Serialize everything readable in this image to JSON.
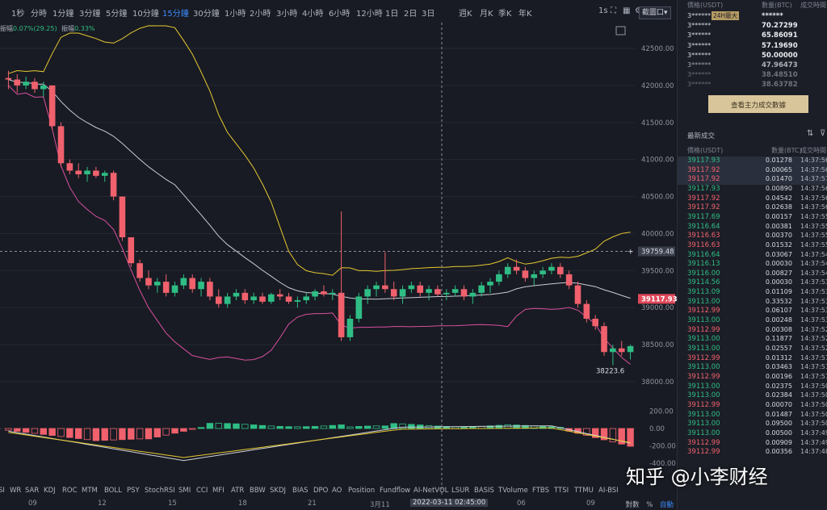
{
  "periods": {
    "items": [
      "1秒",
      "分時",
      "1分鐘",
      "3分鐘",
      "5分鐘",
      "10分鐘",
      "15分鐘",
      "30分鐘",
      "1小時",
      "2小時",
      "3小時",
      "4小時",
      "6小時",
      "12小時",
      "1日",
      "2日",
      "3日",
      "週K",
      "月K",
      "季K",
      "年K"
    ],
    "active": "15分鐘"
  },
  "toolbar": {
    "interval_short": "1s",
    "screenshot_label": "截圖口▾"
  },
  "amplitude": {
    "label": "振幅",
    "change": "0.07%(29.25)",
    "label2": "振幅",
    "value2": "0.33%"
  },
  "price_axis": {
    "ticks": [
      "42500.00",
      "42000.00",
      "41500.00",
      "41000.00",
      "40500.00",
      "40000.00",
      "39500.00",
      "39000.00",
      "38500.00",
      "38000.00"
    ],
    "crosshair_price": "39759.48",
    "last_price": "39117.93",
    "low_label": "38223.6"
  },
  "macd_axis": {
    "ticks": [
      "200.00",
      "0.00",
      "-200.00",
      "-400.00"
    ]
  },
  "indicators": [
    "SI",
    "WR",
    "SAR",
    "KDJ",
    "ROC",
    "MTM",
    "BOLL",
    "PSY",
    "StochRSI",
    "SMI",
    "CCI",
    "MFI",
    "ATR",
    "BBW",
    "SKDJ",
    "BIAS",
    "DPO",
    "AO",
    "Position",
    "Fundflow",
    "AI-NetVOL",
    "LSUR",
    "BASIS",
    "TVolume",
    "FTBS",
    "TTSI",
    "TTMU",
    "AI-BSI"
  ],
  "dates": [
    "09",
    "12",
    "15",
    "18",
    "21",
    "3月11",
    "06",
    "09"
  ],
  "crosshair_date": "2022-03-11 02:45:00",
  "scale_controls": {
    "log": "對數",
    "pct": "%",
    "auto": "自動"
  },
  "right_panel": {
    "top_headers": {
      "addr": "價格(USDT)",
      "amount": "數量(BTC)",
      "time": "成交時間"
    },
    "badge": "24H最大",
    "top_rows": [
      {
        "addr": "3******",
        "amount": "******"
      },
      {
        "addr": "3******",
        "amount": "70.27299"
      },
      {
        "addr": "3******",
        "amount": "65.86091"
      },
      {
        "addr": "3******",
        "amount": "57.19690"
      },
      {
        "addr": "3******",
        "amount": "50.00000"
      },
      {
        "addr": "3******",
        "amount": "47.96473"
      },
      {
        "addr": "3******",
        "amount": "38.48510"
      },
      {
        "addr": "3******",
        "amount": "38.63782"
      }
    ],
    "big_trades_button": "查看主力成交數據",
    "latest_trades_title": "最新成交",
    "trade_headers": {
      "price": "價格(USDT)",
      "qty": "數量(BTC)",
      "time": "成交時間"
    },
    "trades": [
      {
        "price": "39117.93",
        "qty": "0.01278",
        "time": "14:37:56",
        "dir": "up"
      },
      {
        "price": "39117.92",
        "qty": "0.00065",
        "time": "14:37:56",
        "dir": "down"
      },
      {
        "price": "39117.92",
        "qty": "0.01470",
        "time": "14:37:57",
        "dir": "down"
      },
      {
        "price": "39117.93",
        "qty": "0.00890",
        "time": "14:37:56",
        "dir": "up"
      },
      {
        "price": "39117.92",
        "qty": "0.04542",
        "time": "14:37:56",
        "dir": "down"
      },
      {
        "price": "39117.92",
        "qty": "0.02638",
        "time": "14:37:56",
        "dir": "down"
      },
      {
        "price": "39117.69",
        "qty": "0.00157",
        "time": "14:37:55",
        "dir": "up"
      },
      {
        "price": "39116.64",
        "qty": "0.00381",
        "time": "14:37:55",
        "dir": "up"
      },
      {
        "price": "39116.63",
        "qty": "0.00370",
        "time": "14:37:55",
        "dir": "down"
      },
      {
        "price": "39116.63",
        "qty": "0.01532",
        "time": "14:37:55",
        "dir": "down"
      },
      {
        "price": "39116.64",
        "qty": "0.03067",
        "time": "14:37:54",
        "dir": "up"
      },
      {
        "price": "39116.13",
        "qty": "0.00030",
        "time": "14:37:54",
        "dir": "up"
      },
      {
        "price": "39116.00",
        "qty": "0.00827",
        "time": "14:37:54",
        "dir": "up"
      },
      {
        "price": "39114.56",
        "qty": "0.00030",
        "time": "14:37:53",
        "dir": "up"
      },
      {
        "price": "39113.09",
        "qty": "0.01109",
        "time": "14:37:53",
        "dir": "up"
      },
      {
        "price": "39113.00",
        "qty": "0.33532",
        "time": "14:37:53",
        "dir": "up"
      },
      {
        "price": "39112.99",
        "qty": "0.06107",
        "time": "14:37:53",
        "dir": "down"
      },
      {
        "price": "39113.00",
        "qty": "0.00248",
        "time": "14:37:53",
        "dir": "up"
      },
      {
        "price": "39112.99",
        "qty": "0.00308",
        "time": "14:37:52",
        "dir": "down"
      },
      {
        "price": "39113.00",
        "qty": "0.11877",
        "time": "14:37:52",
        "dir": "up"
      },
      {
        "price": "39113.00",
        "qty": "0.02557",
        "time": "14:37:52",
        "dir": "up"
      },
      {
        "price": "39112.99",
        "qty": "0.01312",
        "time": "14:37:51",
        "dir": "down"
      },
      {
        "price": "39113.00",
        "qty": "0.03463",
        "time": "14:37:51",
        "dir": "up"
      },
      {
        "price": "39112.99",
        "qty": "0.00196",
        "time": "14:37:51",
        "dir": "down"
      },
      {
        "price": "39113.00",
        "qty": "0.02375",
        "time": "14:37:50",
        "dir": "up"
      },
      {
        "price": "39113.00",
        "qty": "0.02384",
        "time": "14:37:50",
        "dir": "up"
      },
      {
        "price": "39112.99",
        "qty": "0.00070",
        "time": "14:37:50",
        "dir": "down"
      },
      {
        "price": "39113.00",
        "qty": "0.01487",
        "time": "14:37:50",
        "dir": "up"
      },
      {
        "price": "39113.00",
        "qty": "0.09500",
        "time": "14:37:50",
        "dir": "up"
      },
      {
        "price": "39113.00",
        "qty": "0.00500",
        "time": "14:37:49",
        "dir": "up"
      },
      {
        "price": "39112.99",
        "qty": "0.00909",
        "time": "14:37:49",
        "dir": "down"
      },
      {
        "price": "39112.99",
        "qty": "0.00356",
        "time": "14:37:48",
        "dir": "down"
      }
    ]
  },
  "watermark": "知乎 @小李财经",
  "colors": {
    "up": "#2fbd85",
    "down": "#f0616d",
    "boll_upper": "#e6c832",
    "boll_mid": "#c9ccd4",
    "boll_lower": "#d94fa0",
    "accent": "#3d8bfd"
  },
  "chart_data": {
    "type": "candlestick",
    "price_range": [
      37900,
      42700
    ],
    "candles": [
      {
        "o": 42100,
        "h": 42200,
        "l": 41950,
        "c": 42080
      },
      {
        "o": 42080,
        "h": 42150,
        "l": 41900,
        "c": 42000
      },
      {
        "o": 42000,
        "h": 42120,
        "l": 41950,
        "c": 42050
      },
      {
        "o": 42050,
        "h": 42100,
        "l": 41900,
        "c": 41950
      },
      {
        "o": 41950,
        "h": 42050,
        "l": 41850,
        "c": 42000
      },
      {
        "o": 42000,
        "h": 42000,
        "l": 41400,
        "c": 41450
      },
      {
        "o": 41450,
        "h": 41500,
        "l": 40900,
        "c": 40950
      },
      {
        "o": 40950,
        "h": 41000,
        "l": 40800,
        "c": 40850
      },
      {
        "o": 40850,
        "h": 40950,
        "l": 40750,
        "c": 40800
      },
      {
        "o": 40800,
        "h": 40900,
        "l": 40700,
        "c": 40850
      },
      {
        "o": 40850,
        "h": 40900,
        "l": 40750,
        "c": 40780
      },
      {
        "o": 40780,
        "h": 40850,
        "l": 40700,
        "c": 40820
      },
      {
        "o": 40820,
        "h": 40850,
        "l": 40450,
        "c": 40500
      },
      {
        "o": 40500,
        "h": 40500,
        "l": 39900,
        "c": 39950
      },
      {
        "o": 39950,
        "h": 39950,
        "l": 39550,
        "c": 39600
      },
      {
        "o": 39600,
        "h": 39650,
        "l": 39350,
        "c": 39400
      },
      {
        "o": 39400,
        "h": 39500,
        "l": 39250,
        "c": 39300
      },
      {
        "o": 39300,
        "h": 39400,
        "l": 39200,
        "c": 39350
      },
      {
        "o": 39350,
        "h": 39450,
        "l": 39150,
        "c": 39200
      },
      {
        "o": 39200,
        "h": 39350,
        "l": 39150,
        "c": 39300
      },
      {
        "o": 39300,
        "h": 39450,
        "l": 39250,
        "c": 39400
      },
      {
        "o": 39400,
        "h": 39450,
        "l": 39200,
        "c": 39250
      },
      {
        "o": 39250,
        "h": 39400,
        "l": 39150,
        "c": 39350
      },
      {
        "o": 39350,
        "h": 39400,
        "l": 39100,
        "c": 39150
      },
      {
        "o": 39150,
        "h": 39250,
        "l": 39000,
        "c": 39050
      },
      {
        "o": 39050,
        "h": 39200,
        "l": 39000,
        "c": 39150
      },
      {
        "o": 39150,
        "h": 39250,
        "l": 39100,
        "c": 39200
      },
      {
        "o": 39200,
        "h": 39250,
        "l": 39050,
        "c": 39100
      },
      {
        "o": 39100,
        "h": 39200,
        "l": 39050,
        "c": 39150
      },
      {
        "o": 39150,
        "h": 39200,
        "l": 39050,
        "c": 39080
      },
      {
        "o": 39080,
        "h": 39200,
        "l": 39050,
        "c": 39180
      },
      {
        "o": 39180,
        "h": 39250,
        "l": 39100,
        "c": 39150
      },
      {
        "o": 39150,
        "h": 39200,
        "l": 39050,
        "c": 39080
      },
      {
        "o": 39080,
        "h": 39150,
        "l": 39000,
        "c": 39100
      },
      {
        "o": 39100,
        "h": 39200,
        "l": 39050,
        "c": 39150
      },
      {
        "o": 39150,
        "h": 39250,
        "l": 39100,
        "c": 39220
      },
      {
        "o": 39220,
        "h": 39300,
        "l": 39150,
        "c": 39180
      },
      {
        "o": 39180,
        "h": 39250,
        "l": 39100,
        "c": 39200
      },
      {
        "o": 39200,
        "h": 40300,
        "l": 38550,
        "c": 38600
      },
      {
        "o": 38600,
        "h": 38900,
        "l": 38550,
        "c": 38850
      },
      {
        "o": 38850,
        "h": 39200,
        "l": 38800,
        "c": 39150
      },
      {
        "o": 39150,
        "h": 39300,
        "l": 39050,
        "c": 39250
      },
      {
        "o": 39250,
        "h": 39350,
        "l": 39150,
        "c": 39300
      },
      {
        "o": 39300,
        "h": 39750,
        "l": 39200,
        "c": 39250
      },
      {
        "o": 39250,
        "h": 39350,
        "l": 39100,
        "c": 39150
      },
      {
        "o": 39150,
        "h": 39300,
        "l": 39050,
        "c": 39250
      },
      {
        "o": 39250,
        "h": 39350,
        "l": 39200,
        "c": 39300
      },
      {
        "o": 39300,
        "h": 39350,
        "l": 39150,
        "c": 39200
      },
      {
        "o": 39200,
        "h": 39300,
        "l": 39100,
        "c": 39250
      },
      {
        "o": 39250,
        "h": 39300,
        "l": 39150,
        "c": 39180
      },
      {
        "o": 39180,
        "h": 39250,
        "l": 39100,
        "c": 39200
      },
      {
        "o": 39200,
        "h": 39300,
        "l": 39150,
        "c": 39250
      },
      {
        "o": 39250,
        "h": 39300,
        "l": 39100,
        "c": 39150
      },
      {
        "o": 39150,
        "h": 39250,
        "l": 39050,
        "c": 39200
      },
      {
        "o": 39200,
        "h": 39350,
        "l": 39150,
        "c": 39300
      },
      {
        "o": 39300,
        "h": 39400,
        "l": 39200,
        "c": 39350
      },
      {
        "o": 39350,
        "h": 39500,
        "l": 39300,
        "c": 39450
      },
      {
        "o": 39450,
        "h": 39600,
        "l": 39400,
        "c": 39550
      },
      {
        "o": 39550,
        "h": 39650,
        "l": 39450,
        "c": 39500
      },
      {
        "o": 39500,
        "h": 39550,
        "l": 39350,
        "c": 39400
      },
      {
        "o": 39400,
        "h": 39500,
        "l": 39300,
        "c": 39450
      },
      {
        "o": 39450,
        "h": 39550,
        "l": 39400,
        "c": 39500
      },
      {
        "o": 39500,
        "h": 39600,
        "l": 39450,
        "c": 39550
      },
      {
        "o": 39550,
        "h": 39600,
        "l": 39400,
        "c": 39450
      },
      {
        "o": 39450,
        "h": 39500,
        "l": 39250,
        "c": 39300
      },
      {
        "o": 39300,
        "h": 39350,
        "l": 39000,
        "c": 39050
      },
      {
        "o": 39050,
        "h": 39100,
        "l": 38800,
        "c": 38850
      },
      {
        "o": 38850,
        "h": 38900,
        "l": 38700,
        "c": 38750
      },
      {
        "o": 38750,
        "h": 38800,
        "l": 38350,
        "c": 38400
      },
      {
        "o": 38400,
        "h": 38500,
        "l": 38223,
        "c": 38450
      },
      {
        "o": 38450,
        "h": 38550,
        "l": 38350,
        "c": 38400
      },
      {
        "o": 38400,
        "h": 38500,
        "l": 38300,
        "c": 38480
      }
    ]
  }
}
